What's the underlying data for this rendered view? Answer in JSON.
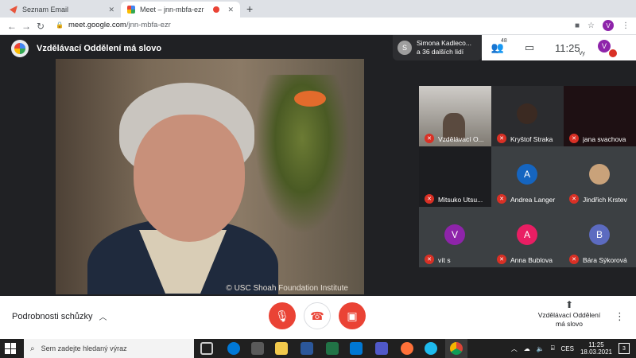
{
  "browser": {
    "tabs": [
      {
        "title": "Seznam Email",
        "close": "✕",
        "favicon_color": "#e8553c"
      },
      {
        "title": "Meet – jnn-mbfa-ezr",
        "close": "✕",
        "favicon_color": "#00897b"
      }
    ],
    "new_tab": "+",
    "back": "←",
    "forward": "→",
    "reload": "↻",
    "url_host": "meet.google.com",
    "url_path": "/jnn-mbfa-ezr",
    "profile_initial": "V"
  },
  "meet": {
    "title": "Vzdělávací Oddělení má slovo",
    "presenter": {
      "initial": "S",
      "line1": "Simona Kadleco...",
      "line2": "a 36 dalších lidí"
    },
    "participants_count": "48",
    "clock": "11:25",
    "you_label": "Vy",
    "you_initial": "V",
    "main_watermark": "© USC Shoah Foundation Institute",
    "tiles": [
      {
        "name": "Vzdělávací O...",
        "kind": "video"
      },
      {
        "name": "Kryštof Straka",
        "kind": "photo",
        "color": "#3b2a22"
      },
      {
        "name": "jana svachova",
        "kind": "empty"
      },
      {
        "name": "Mitsuko Utsu...",
        "kind": "empty"
      },
      {
        "name": "Andrea Langer",
        "kind": "avatar",
        "initial": "A",
        "color": "#1565c0"
      },
      {
        "name": "Jindřich Krstev",
        "kind": "photo",
        "color": "#c9a27a"
      },
      {
        "name": "vít s",
        "kind": "avatar",
        "initial": "V",
        "color": "#8e24aa"
      },
      {
        "name": "Anna Bublova",
        "kind": "avatar",
        "initial": "A",
        "color": "#e91e63"
      },
      {
        "name": "Bára Sýkorová",
        "kind": "avatar",
        "initial": "B",
        "color": "#5c6bc0"
      }
    ]
  },
  "controls": {
    "details_label": "Podrobnosti schůzky",
    "present_line1": "Vzdělávací Oddělení",
    "present_line2": "má slovo",
    "more": "⋮"
  },
  "taskbar": {
    "search_placeholder": "Sem zadejte hledaný výraz",
    "time": "11:25",
    "date": "18.03.2021",
    "language": "CES",
    "notif_count": "3"
  }
}
